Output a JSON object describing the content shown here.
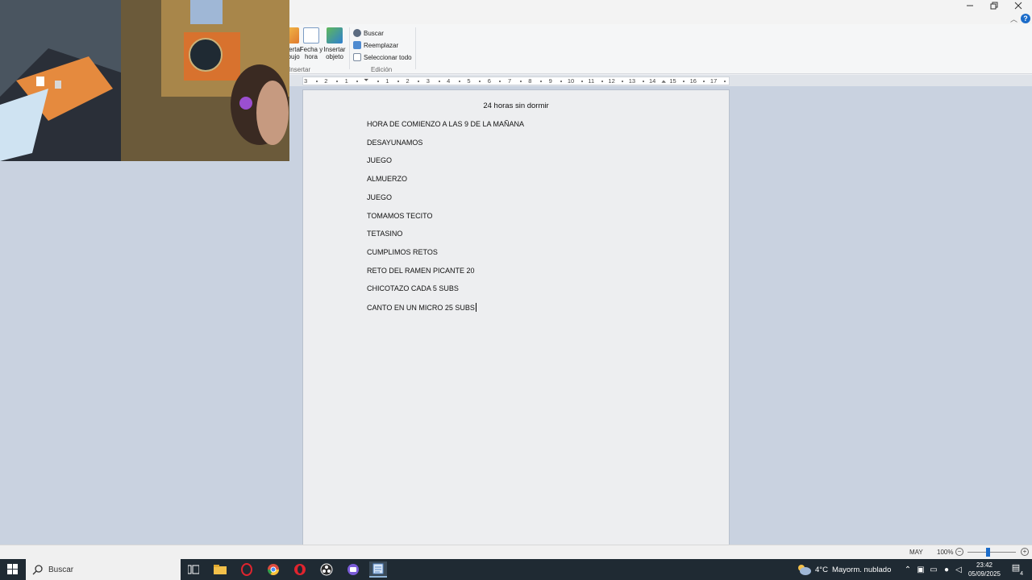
{
  "ribbon": {
    "insert_group": {
      "label": "Insertar",
      "items": [
        {
          "label": "Insertar dibujo",
          "icon": "paint-icon"
        },
        {
          "label": "Fecha y hora",
          "icon": "calendar-clock-icon"
        },
        {
          "label": "Insertar objeto",
          "icon": "object-icon"
        }
      ]
    },
    "edit_group": {
      "label": "Edición",
      "items": [
        {
          "label": "Buscar",
          "icon": "binoculars-icon"
        },
        {
          "label": "Reemplazar",
          "icon": "replace-icon"
        },
        {
          "label": "Seleccionar todo",
          "icon": "select-all-icon"
        }
      ]
    }
  },
  "ruler": {
    "numbers": [
      "3",
      "2",
      "1",
      "1",
      "2",
      "3",
      "4",
      "5",
      "6",
      "7",
      "8",
      "9",
      "10",
      "11",
      "12",
      "13",
      "14",
      "15",
      "16",
      "17"
    ]
  },
  "document": {
    "title": "24 horas sin dormir",
    "lines": [
      "HORA DE COMIENZO A LAS 9 DE LA MAÑANA",
      "DESAYUNAMOS",
      "JUEGO",
      "ALMUERZO",
      "JUEGO",
      "TOMAMOS TECITO",
      "TETASINO",
      "CUMPLIMOS RETOS",
      "RETO DEL RAMEN PICANTE 20",
      "CHICOTAZO CADA 5 SUBS",
      "CANTO EN UN MICRO 25 SUBS"
    ]
  },
  "status": {
    "caps": "MAY",
    "zoom": "100%",
    "zoom_level_percent": 100
  },
  "taskbar": {
    "search_placeholder": "Buscar",
    "weather_temp": "4°C",
    "weather_text": "Mayorm. nublado",
    "time": "23:42",
    "date": "05/09/2025",
    "notifications": "4"
  },
  "colors": {
    "accent": "#1c6cc9",
    "canvas_bg": "#c9d2e0",
    "taskbar_bg": "#1f2a33"
  }
}
